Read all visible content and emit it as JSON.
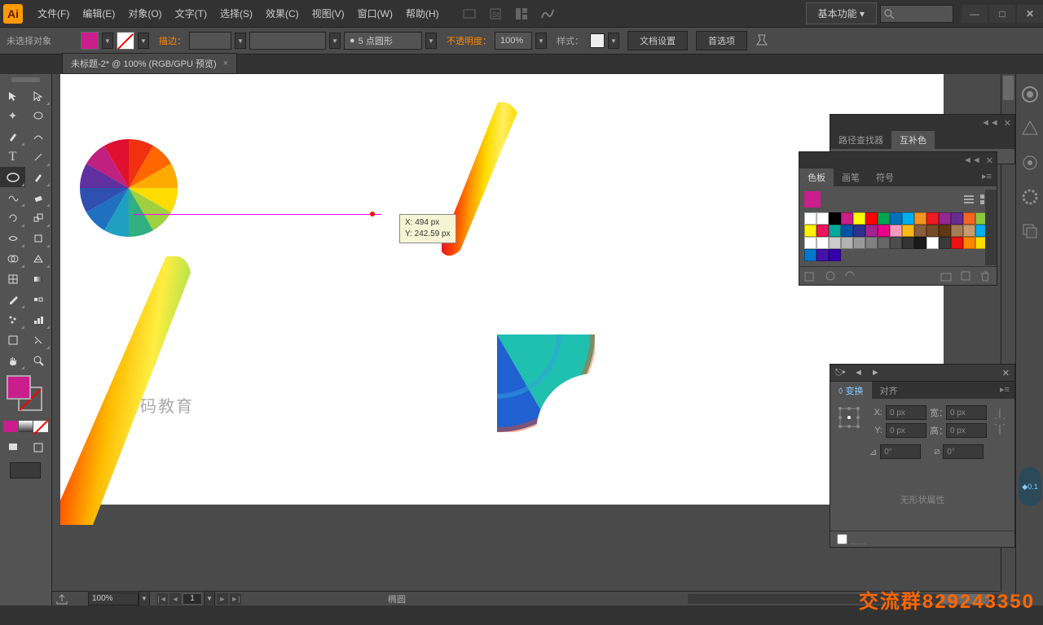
{
  "app": {
    "logo": "Ai"
  },
  "menu": [
    "文件(F)",
    "编辑(E)",
    "对象(O)",
    "文字(T)",
    "选择(S)",
    "效果(C)",
    "视图(V)",
    "窗口(W)",
    "帮助(H)"
  ],
  "workspace": "基本功能",
  "control": {
    "selection": "未选择对象",
    "stroke_label": "描边：",
    "brush_shape": "5 点圆形",
    "brush_bullet": "●",
    "opacity_label": "不透明度：",
    "opacity_value": "100%",
    "style_label": "样式：",
    "doc_setup": "文档设置",
    "prefs": "首选项"
  },
  "tab": {
    "title": "未标题-2* @ 100% (RGB/GPU 预览)",
    "close": "×"
  },
  "coord": {
    "x": "X: 494 px",
    "y": "Y: 242.59 px"
  },
  "zoom": "100%",
  "page": "1",
  "shape_name": "椭圆",
  "panels": {
    "pathfinder": "路径查找器",
    "complement": "互补色",
    "swatches": "色板",
    "brushes": "画笔",
    "symbols": "符号",
    "transform": "变换",
    "align": "对齐",
    "noshape": "无形状属性",
    "x_lbl": "X:",
    "y_lbl": "Y:",
    "w_lbl": "宽：",
    "h_lbl": "高：",
    "x_val": "0 px",
    "y_val": "0 px",
    "w_val": "0 px",
    "h_val": "0 px",
    "r_val": "0°",
    "s_val": "0°"
  },
  "swatch_colors": [
    "#ffffff",
    "#ffffff",
    "#000000",
    "#c91e8c",
    "#ffff00",
    "#ff0000",
    "#00a651",
    "#0072bc",
    "#00aeef",
    "#f7941d",
    "#ed1c24",
    "#92278f",
    "#662d91",
    "#f26522",
    "#8dc63f",
    "#fff200",
    "#ed145b",
    "#00a99d",
    "#0054a6",
    "#2e3192",
    "#a3238e",
    "#ec008c",
    "#f49ac1",
    "#fdb913",
    "#8b5e3c",
    "#754c24",
    "#603913",
    "#a67c52",
    "#c69c6d",
    "#00adef",
    "#ffffff",
    "#ffffff",
    "#cccccc",
    "#b3b3b3",
    "#999999",
    "#808080",
    "#666666",
    "#4d4d4d",
    "#333333",
    "#1a1a1a",
    "#ffffff",
    "#3a3a3a",
    "#e11",
    "#f80",
    "#fd0",
    "#07c",
    "#41a",
    "#30a"
  ],
  "watermark": "交流群829243350",
  "stamp": "码教育",
  "badge": "0.1"
}
